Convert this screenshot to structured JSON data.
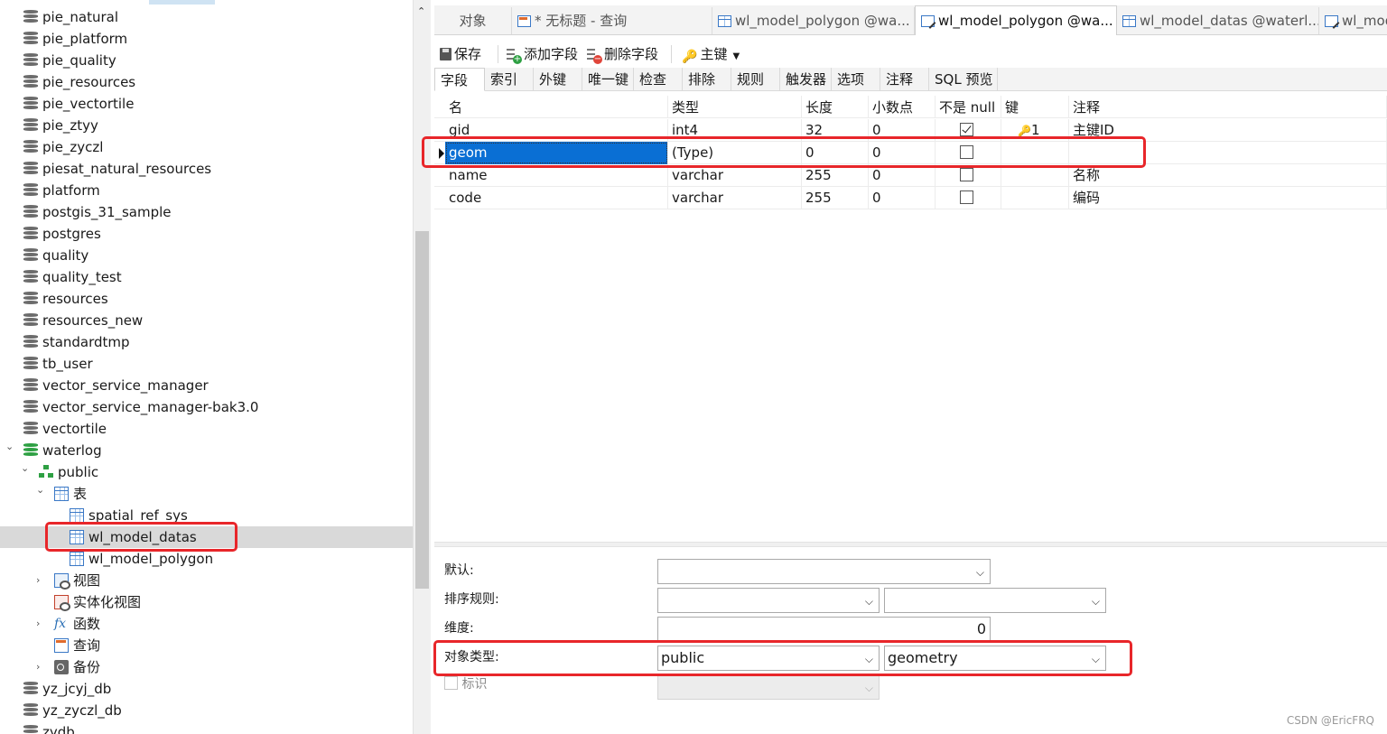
{
  "tree": {
    "items": [
      {
        "label": "pie_natural",
        "icon": "database-icon"
      },
      {
        "label": "pie_platform",
        "icon": "database-icon"
      },
      {
        "label": "pie_quality",
        "icon": "database-icon"
      },
      {
        "label": "pie_resources",
        "icon": "database-icon"
      },
      {
        "label": "pie_vectortile",
        "icon": "database-icon"
      },
      {
        "label": "pie_ztyy",
        "icon": "database-icon"
      },
      {
        "label": "pie_zyczl",
        "icon": "database-icon"
      },
      {
        "label": "piesat_natural_resources",
        "icon": "database-icon"
      },
      {
        "label": "platform",
        "icon": "database-icon"
      },
      {
        "label": "postgis_31_sample",
        "icon": "database-icon"
      },
      {
        "label": "postgres",
        "icon": "database-icon"
      },
      {
        "label": "quality",
        "icon": "database-icon"
      },
      {
        "label": "quality_test",
        "icon": "database-icon"
      },
      {
        "label": "resources",
        "icon": "database-icon"
      },
      {
        "label": "resources_new",
        "icon": "database-icon"
      },
      {
        "label": "standardtmp",
        "icon": "database-icon"
      },
      {
        "label": "tb_user",
        "icon": "database-icon"
      },
      {
        "label": "vector_service_manager",
        "icon": "database-icon"
      },
      {
        "label": "vector_service_manager-bak3.0",
        "icon": "database-icon"
      },
      {
        "label": "vectortile",
        "icon": "database-icon"
      },
      {
        "label": "waterlog",
        "icon": "database-open-icon"
      },
      {
        "label": "public",
        "icon": "schema-icon"
      },
      {
        "label": "表",
        "icon": "tables-folder-icon"
      },
      {
        "label": "spatial_ref_sys",
        "icon": "table-icon"
      },
      {
        "label": "wl_model_datas",
        "icon": "table-icon"
      },
      {
        "label": "wl_model_polygon",
        "icon": "table-icon"
      },
      {
        "label": "视图",
        "icon": "view-icon"
      },
      {
        "label": "实体化视图",
        "icon": "materialized-view-icon"
      },
      {
        "label": "函数",
        "icon": "function-icon"
      },
      {
        "label": "查询",
        "icon": "query-icon"
      },
      {
        "label": "备份",
        "icon": "backup-icon"
      },
      {
        "label": "yz_jcyj_db",
        "icon": "database-icon"
      },
      {
        "label": "yz_zyczl_db",
        "icon": "database-icon"
      },
      {
        "label": "zydb",
        "icon": "database-icon"
      }
    ]
  },
  "tabs": [
    {
      "label": "对象"
    },
    {
      "label": "* 无标题 - 查询"
    },
    {
      "label": "wl_model_polygon @wa..."
    },
    {
      "label": "wl_model_polygon @wa..."
    },
    {
      "label": "wl_model_datas @waterl..."
    },
    {
      "label": "wl_mod"
    }
  ],
  "toolbar": {
    "save": "保存",
    "add_field": "添加字段",
    "delete_field": "删除字段",
    "primary_key": "主键"
  },
  "subtabs": [
    "字段",
    "索引",
    "外键",
    "唯一键",
    "检查",
    "排除",
    "规则",
    "触发器",
    "选项",
    "注释",
    "SQL 预览"
  ],
  "grid": {
    "headers": [
      "名",
      "类型",
      "长度",
      "小数点",
      "不是 null",
      "键",
      "注释"
    ],
    "rows": [
      {
        "name": "gid",
        "type": "int4",
        "length": "32",
        "decimals": "0",
        "not_null": true,
        "key": "1",
        "comment": "主键ID"
      },
      {
        "name": "geom",
        "type": "(Type)",
        "length": "0",
        "decimals": "0",
        "not_null": false,
        "key": "",
        "comment": ""
      },
      {
        "name": "name",
        "type": "varchar",
        "length": "255",
        "decimals": "0",
        "not_null": false,
        "key": "",
        "comment": "名称"
      },
      {
        "name": "code",
        "type": "varchar",
        "length": "255",
        "decimals": "0",
        "not_null": false,
        "key": "",
        "comment": "编码"
      }
    ]
  },
  "props": {
    "default_label": "默认:",
    "collation_label": "排序规则:",
    "dimension_label": "维度:",
    "dimension_value": "0",
    "object_type_label": "对象类型:",
    "object_type_schema": "public",
    "object_type_name": "geometry",
    "identity_label": "标识"
  },
  "watermark": "CSDN @EricFRQ",
  "colors": {
    "selection": "#0a6fd4",
    "highlight_box": "#e8262a",
    "tree_selected": "#d9d9d9"
  }
}
